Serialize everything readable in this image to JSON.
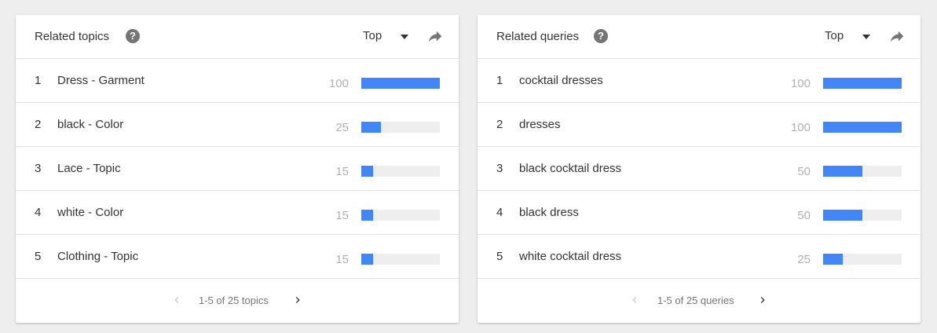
{
  "colors": {
    "bar_fill": "#4285f4",
    "bar_track": "#eeeeee",
    "value_text": "#b0b0b0"
  },
  "topics": {
    "title": "Related topics",
    "help_icon": "help-icon",
    "filter": {
      "selected": "Top",
      "icon": "caret-down-icon"
    },
    "share_icon": "share-icon",
    "rows": [
      {
        "rank": "1",
        "label": "Dress - Garment",
        "value": "100",
        "fraction": 1.0
      },
      {
        "rank": "2",
        "label": "black - Color",
        "value": "25",
        "fraction": 0.25
      },
      {
        "rank": "3",
        "label": "Lace - Topic",
        "value": "15",
        "fraction": 0.15
      },
      {
        "rank": "4",
        "label": "white - Color",
        "value": "15",
        "fraction": 0.15
      },
      {
        "rank": "5",
        "label": "Clothing - Topic",
        "value": "15",
        "fraction": 0.15
      }
    ],
    "pager": {
      "text": "1-5 of 25 topics",
      "prev_icon": "chevron-left-icon",
      "next_icon": "chevron-right-icon"
    }
  },
  "queries": {
    "title": "Related queries",
    "help_icon": "help-icon",
    "filter": {
      "selected": "Top",
      "icon": "caret-down-icon"
    },
    "share_icon": "share-icon",
    "rows": [
      {
        "rank": "1",
        "label": "cocktail dresses",
        "value": "100",
        "fraction": 1.0
      },
      {
        "rank": "2",
        "label": "dresses",
        "value": "100",
        "fraction": 1.0
      },
      {
        "rank": "3",
        "label": "black cocktail dress",
        "value": "50",
        "fraction": 0.5
      },
      {
        "rank": "4",
        "label": "black dress",
        "value": "50",
        "fraction": 0.5
      },
      {
        "rank": "5",
        "label": "white cocktail dress",
        "value": "25",
        "fraction": 0.25
      }
    ],
    "pager": {
      "text": "1-5 of 25 queries",
      "prev_icon": "chevron-left-icon",
      "next_icon": "chevron-right-icon"
    }
  }
}
